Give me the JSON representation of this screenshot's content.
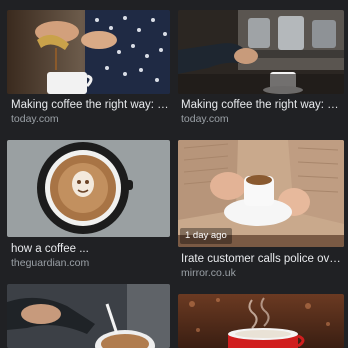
{
  "results": [
    {
      "title": "Making coffee the right way: Ne...",
      "source": "today.com",
      "image": "coffee-pour-over-photo"
    },
    {
      "title": "Making coffee the right way: Ne...",
      "source": "today.com",
      "image": "espresso-machine-photo"
    },
    {
      "title": "how a coffee ...",
      "source": "theguardian.com",
      "image": "latte-art-cup-photo"
    },
    {
      "title": "Irate customer calls police over ...",
      "source": "mirror.co.uk",
      "image": "hands-holding-espresso-photo",
      "badge": "1 day ago"
    },
    {
      "image": "latte-pour-photo"
    },
    {
      "image": "steaming-red-cup-photo"
    }
  ],
  "colors": {
    "background": "#202124",
    "title_text": "#e8eaed",
    "source_text": "#9aa0a6"
  }
}
